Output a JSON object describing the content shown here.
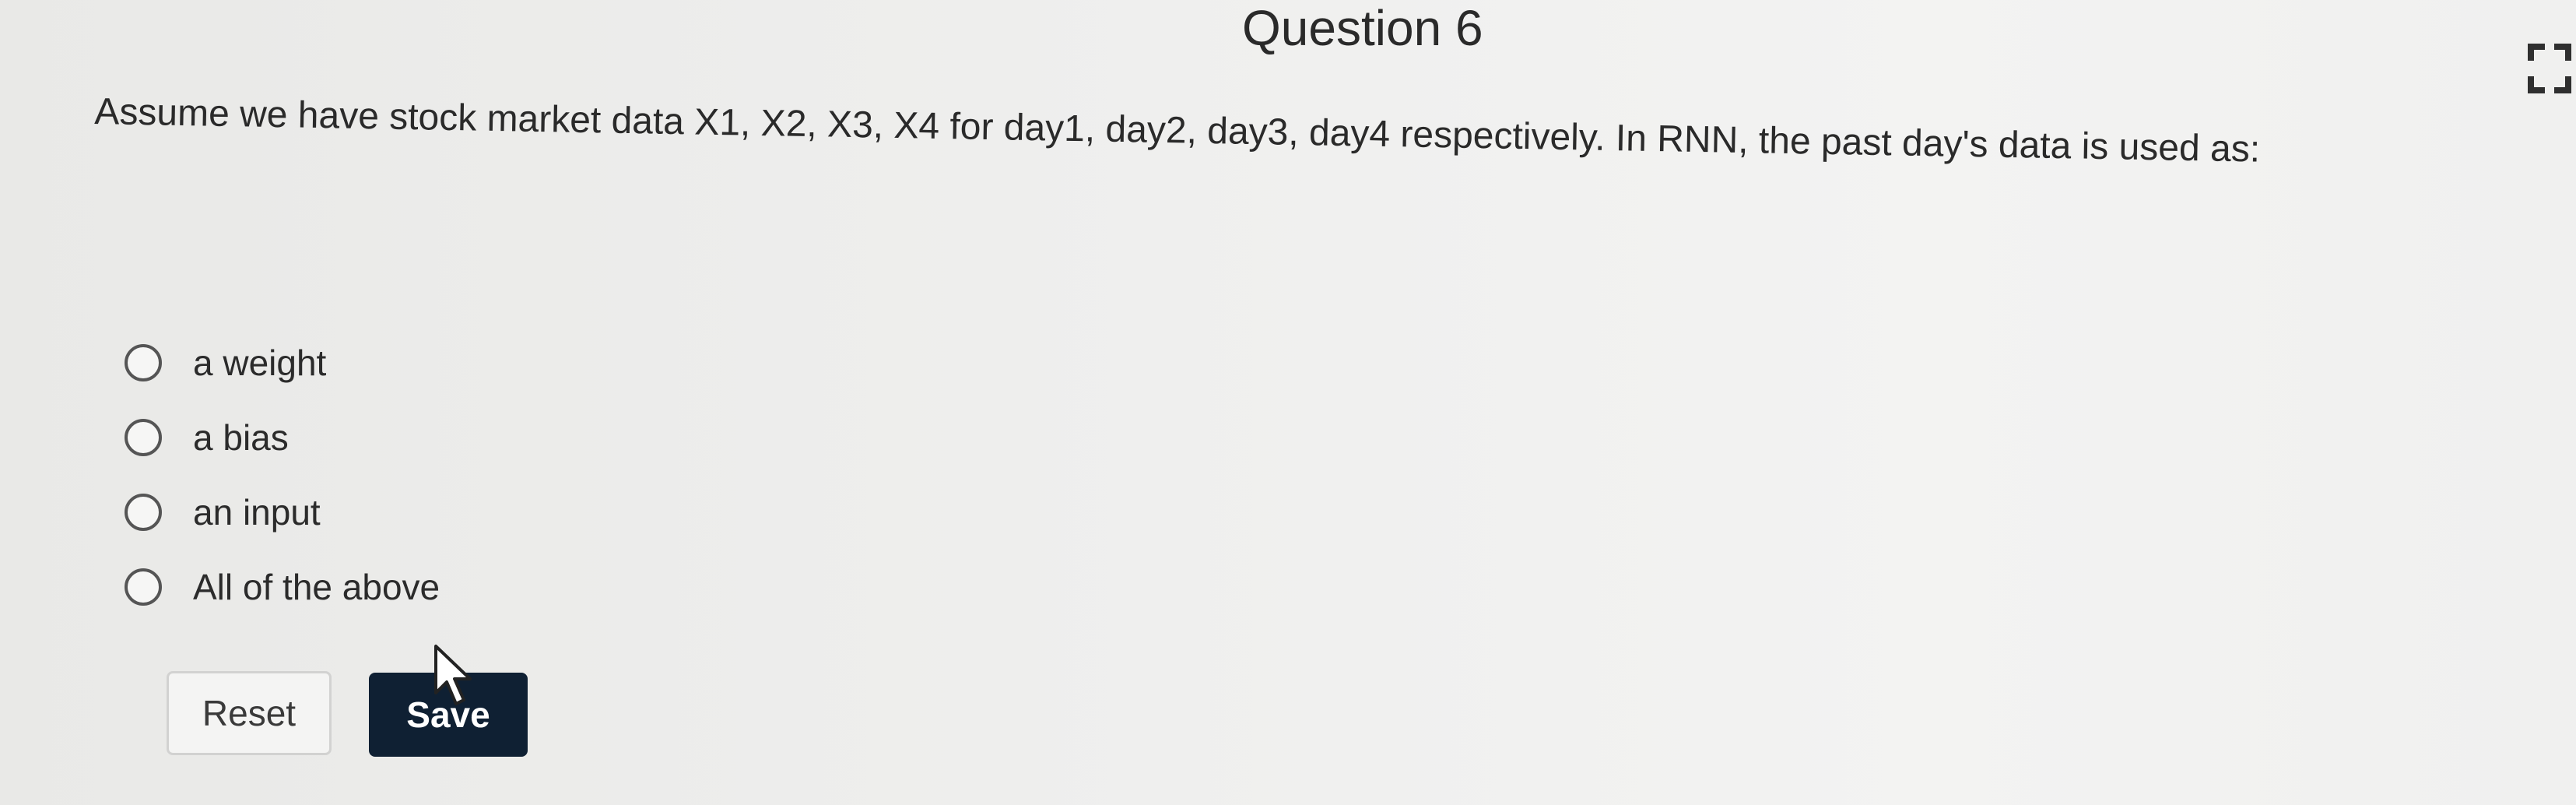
{
  "question": {
    "title": "Question 6",
    "text": "Assume we have stock market data X1, X2, X3, X4 for day1, day2, day3, day4 respectively. In RNN, the past day's data is used as:"
  },
  "options": [
    {
      "label": "a weight",
      "selected": false
    },
    {
      "label": "a bias",
      "selected": false
    },
    {
      "label": "an input",
      "selected": false
    },
    {
      "label": "All of the above",
      "selected": false
    }
  ],
  "buttons": {
    "reset_label": "Reset",
    "save_label": "Save"
  },
  "icons": {
    "fullscreen": "fullscreen-icon",
    "cursor": "mouse-pointer-icon"
  },
  "colors": {
    "save_button_bg": "#0f2033",
    "save_button_text": "#ffffff",
    "text": "#2a2a2a"
  }
}
